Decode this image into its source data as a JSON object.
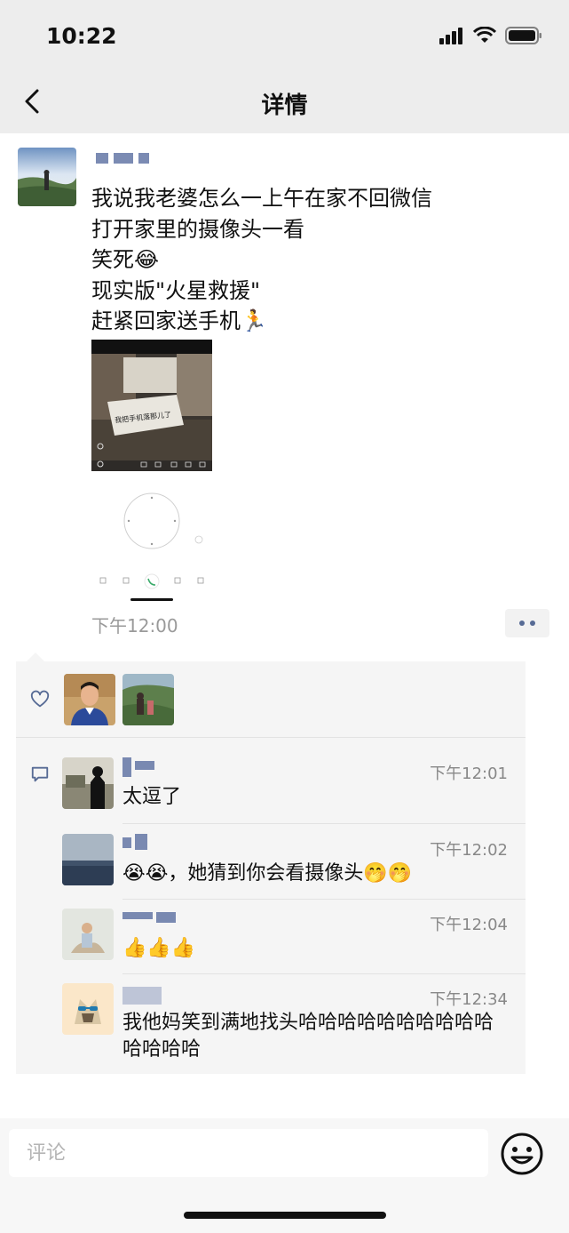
{
  "status_bar": {
    "time": "10:22"
  },
  "nav": {
    "title": "详情"
  },
  "post": {
    "text": "我说我老婆怎么一上午在家不回微信\n打开家里的摄像头一看\n笑死😂\n现实版\"火星救援\"\n赶紧回家送手机🏃",
    "time": "下午12:00",
    "image_note_text": "我把手机落那儿了"
  },
  "comments": [
    {
      "time": "下午12:01",
      "text": "太逗了"
    },
    {
      "time": "下午12:02",
      "text": "😭😭，她猜到你会看摄像头🤭🤭"
    },
    {
      "time": "下午12:04",
      "text": "👍👍👍"
    },
    {
      "time": "下午12:34",
      "text": "我他妈笑到满地找头哈哈哈哈哈哈哈哈哈哈哈哈哈哈"
    }
  ],
  "input": {
    "placeholder": "评论"
  },
  "colors": {
    "link_blue": "#576b95",
    "bar_gray": "#ededed",
    "panel_gray": "#f5f5f5"
  }
}
